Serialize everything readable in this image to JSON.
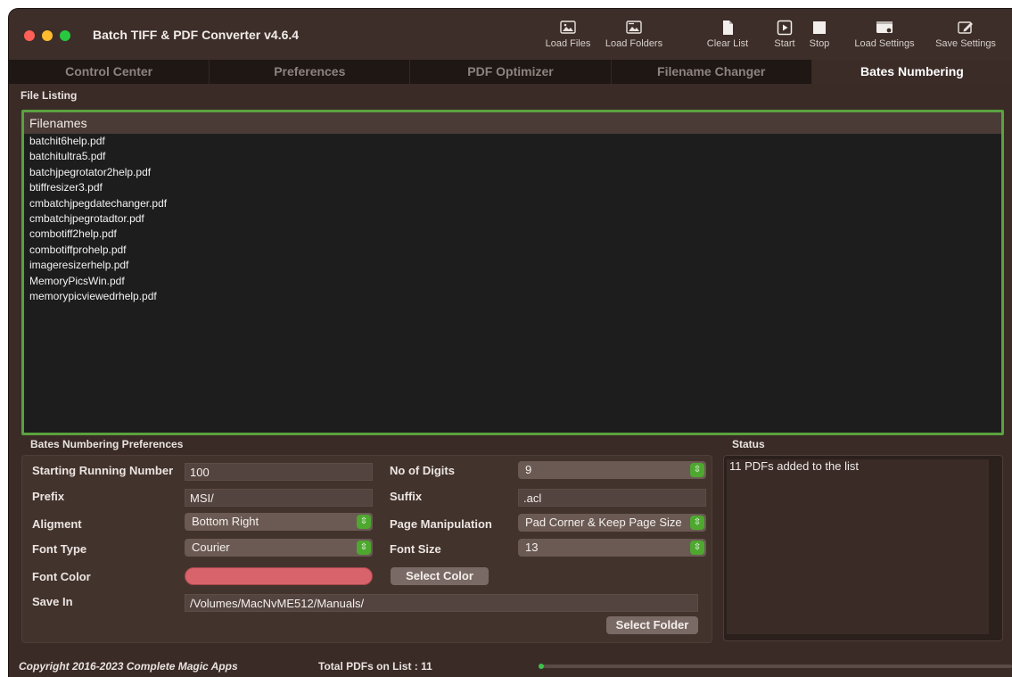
{
  "window": {
    "title": "Batch TIFF & PDF Converter v4.6.4"
  },
  "toolbar": {
    "load_files": "Load Files",
    "load_folders": "Load Folders",
    "clear_list": "Clear List",
    "start": "Start",
    "stop": "Stop",
    "load_settings": "Load Settings",
    "save_settings": "Save Settings"
  },
  "tabs": [
    {
      "label": "Control Center",
      "active": false
    },
    {
      "label": "Preferences",
      "active": false
    },
    {
      "label": "PDF Optimizer",
      "active": false
    },
    {
      "label": "Filename Changer",
      "active": false
    },
    {
      "label": "Bates Numbering",
      "active": true
    }
  ],
  "file_listing": {
    "section_label": "File Listing",
    "header": "Filenames",
    "files": [
      "batchit6help.pdf",
      "batchitultra5.pdf",
      "batchjpegrotator2help.pdf",
      "btiffresizer3.pdf",
      "cmbatchjpegdatechanger.pdf",
      "cmbatchjpegrotadtor.pdf",
      "combotiff2help.pdf",
      "combotiffprohelp.pdf",
      "imageresizerhelp.pdf",
      "MemoryPicsWin.pdf",
      "memorypicviewedrhelp.pdf"
    ]
  },
  "bates": {
    "section_label": "Bates Numbering Preferences",
    "starting_number_label": "Starting Running Number",
    "starting_number": "100",
    "digits_label": "No of Digits",
    "digits": "9",
    "prefix_label": "Prefix",
    "prefix": "MSI/",
    "suffix_label": "Suffix",
    "suffix": ".acl",
    "alignment_label": "Aligment",
    "alignment": "Bottom Right",
    "page_manipulation_label": "Page Manipulation",
    "page_manipulation": "Pad Corner & Keep Page Size",
    "font_type_label": "Font Type",
    "font_type": "Courier",
    "font_size_label": "Font Size",
    "font_size": "13",
    "font_color_label": "Font Color",
    "font_color": "#d9636a",
    "select_color": "Select Color",
    "save_in_label": "Save In",
    "save_in": "/Volumes/MacNvME512/Manuals/",
    "select_folder": "Select Folder"
  },
  "status": {
    "section_label": "Status",
    "message": "11 PDFs added to the list"
  },
  "footer": {
    "copyright": "Copyright 2016-2023 Complete Magic Apps",
    "total": "Total PDFs on List : 11",
    "progress_fraction": 0.0
  },
  "colors": {
    "accent_green": "#5aa23f",
    "window_bg": "#3a2b26"
  }
}
